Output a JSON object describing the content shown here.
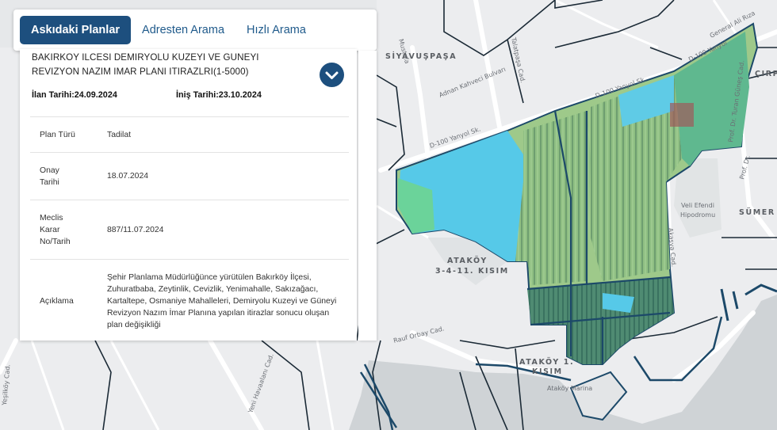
{
  "tabs": [
    {
      "label": "Askıdaki Planlar",
      "active": true
    },
    {
      "label": "Adresten Arama",
      "active": false
    },
    {
      "label": "Hızlı Arama",
      "active": false
    }
  ],
  "plan": {
    "title": "BAKIRKOY ILCESI DEMIRYOLU KUZEYI VE GUNEYI REVIZYON NAZIM IMAR PLANI ITIRAZLRI(1-5000)",
    "ilan_tarihi": "İlan Tarihi:24.09.2024",
    "inis_tarihi": "İniş Tarihi:23.10.2024",
    "rows": [
      {
        "key": "Plan Türü",
        "value": "Tadilat"
      },
      {
        "key": "Onay Tarihi",
        "value": "18.07.2024"
      },
      {
        "key": "Meclis Karar No/Tarih",
        "value": "887/11.07.2024"
      },
      {
        "key": "Açıklama",
        "value": "Şehir Planlama Müdürlüğünce yürütülen Bakırköy İlçesi, Zuhuratbaba, Zeytinlik, Cevizlik, Yenimahalle, Sakızağacı, Kartaltepe, Osmaniye Mahalleleri, Demiryolu Kuzeyi ve Güneyi Revizyon Nazım İmar Planına yapılan itirazlar sonucu oluşan plan değişikliği"
      }
    ]
  },
  "map": {
    "districts": {
      "siyavuspasa": "SİYAVUŞPAŞA",
      "atakoy_3411_l1": "ATAKÖY",
      "atakoy_3411_l2": "3-4-11. KISIM",
      "atakoy_1_l1": "ATAKÖY 1.",
      "atakoy_1_l2": "KISIM",
      "sumer": "SÜMER",
      "cirpici": "ÇIRP"
    },
    "labels": {
      "d100_1": "D-100 Yanyol Sk.",
      "d100_2": "D-100 Yanyol Sk.",
      "d100_3": "D-100 Yanyol",
      "general_ali": "General Ali Rıza",
      "mustafa": "Mustafa",
      "kahveci": "Adnan Kahveci Bulvarı",
      "talatpasa": "Talatpaşa Cad.",
      "veli1": "Veli Efendi",
      "veli2": "Hipodromu",
      "turan": "Prof. Dr. Turan Güneş Cad.",
      "turan2": "Prof. Dr.",
      "akasya": "Akasya Cad.",
      "rauf": "Rauf Orbay Cad.",
      "havalani": "Yeni Havaalanı Cad.",
      "yesilkoy": "Yeşilköy Cad.",
      "atakoy_marina": "Ataköy Marina"
    },
    "colors": {
      "water": "#cfd3d6",
      "land": "#ecedef",
      "boundary": "#1c4969",
      "plan_cyan": "#56c9e8",
      "plan_green": "#9ec98a",
      "plan_dark": "#3e7f6c"
    }
  }
}
